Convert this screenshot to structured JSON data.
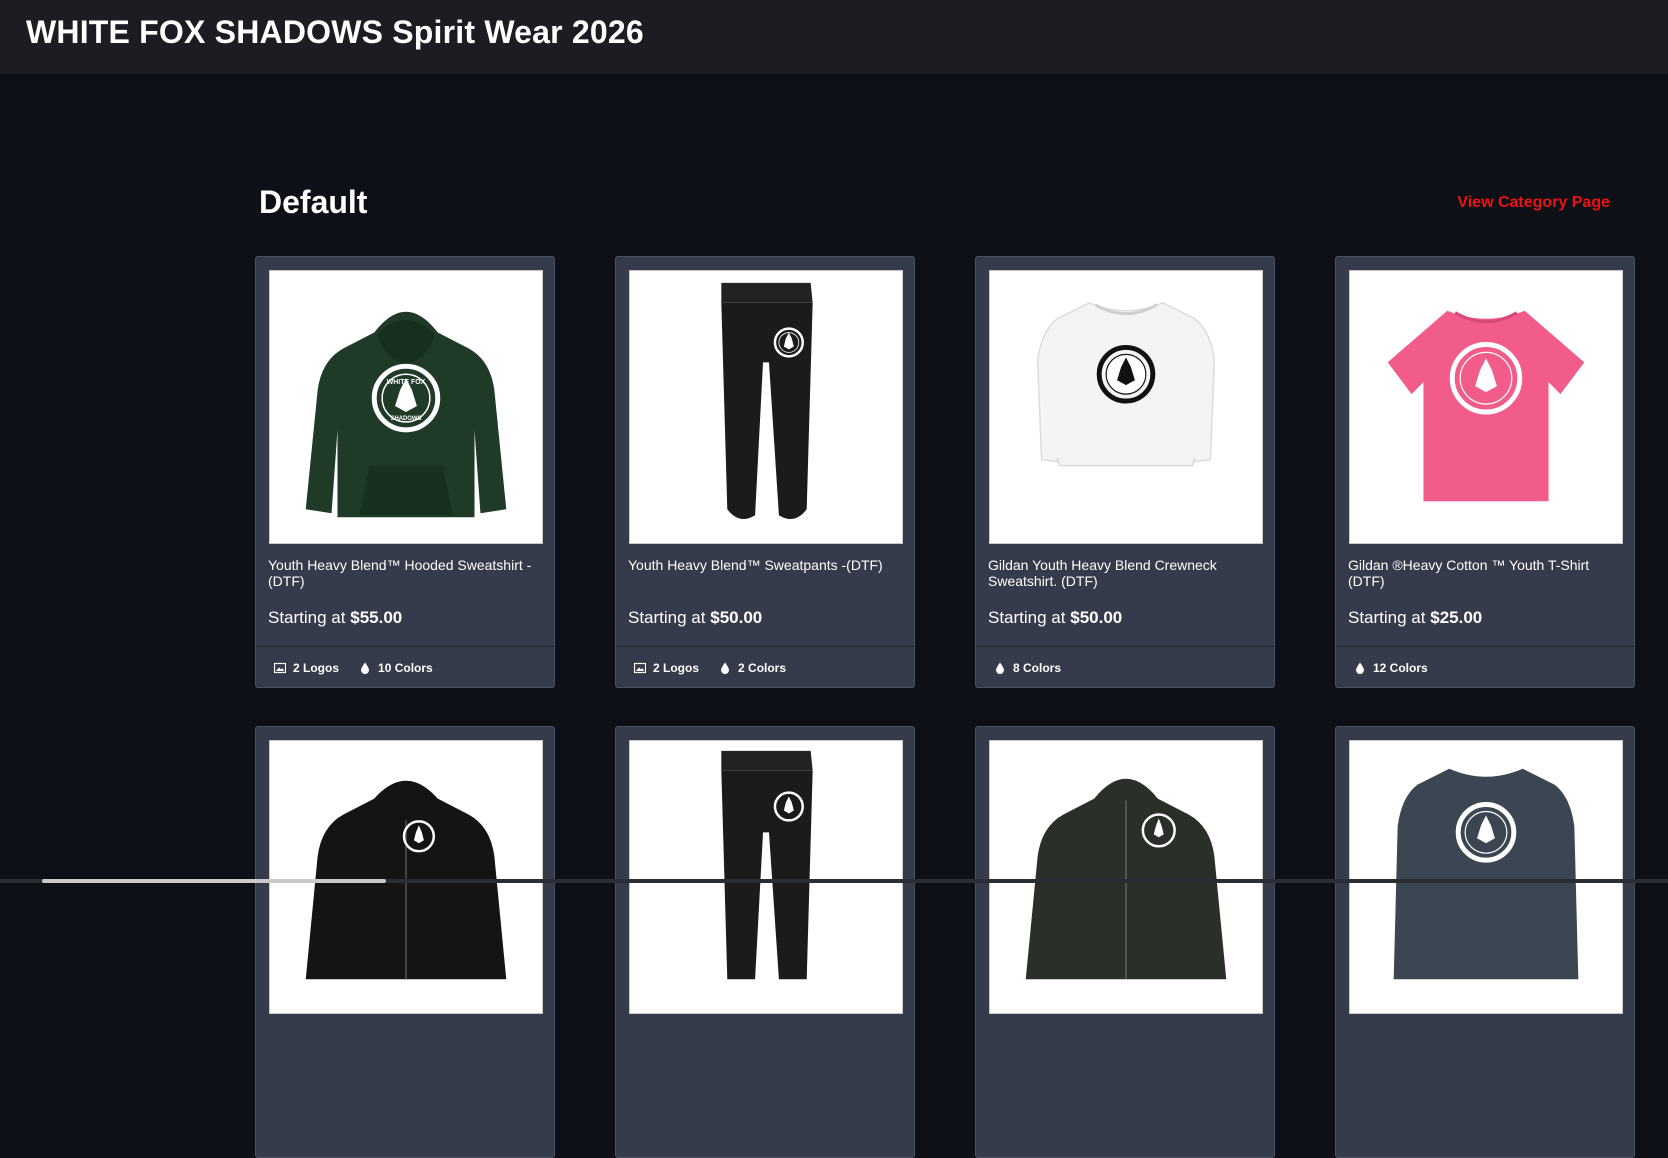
{
  "header": {
    "title": "WHITE FOX SHADOWS Spirit Wear 2026"
  },
  "category": {
    "title": "Default",
    "link_label": "View Category Page"
  },
  "colors": {
    "accent_link": "#ee1111",
    "card_bg": "#353b4a",
    "page_bg": "#0d1117",
    "topbar_bg": "#1b1d22"
  },
  "products": [
    {
      "name": "Youth Heavy Blend™ Hooded Sweatshirt - (DTF)",
      "price_prefix": "Starting at",
      "price": "$55.00",
      "logos": "2 Logos",
      "colors_count": "10 Colors",
      "icon": "hoodie-dark-green"
    },
    {
      "name": "Youth Heavy Blend™ Sweatpants -(DTF)",
      "price_prefix": "Starting at",
      "price": "$50.00",
      "logos": "2 Logos",
      "colors_count": "2 Colors",
      "icon": "sweatpants-black"
    },
    {
      "name": "Gildan Youth Heavy Blend Crewneck Sweatshirt. (DTF)",
      "price_prefix": "Starting at",
      "price": "$50.00",
      "colors_count": "8 Colors",
      "icon": "crewneck-white"
    },
    {
      "name": "Gildan ®Heavy Cotton ™ Youth T-Shirt (DTF)",
      "price_prefix": "Starting at",
      "price": "$25.00",
      "colors_count": "12 Colors",
      "icon": "tshirt-pink"
    },
    {
      "icon": "zip-hoodie-black"
    },
    {
      "icon": "sweatpants-black"
    },
    {
      "icon": "zip-hoodie-dark-green"
    },
    {
      "icon": "crewneck-charcoal"
    }
  ],
  "logo_text": {
    "top": "WHITE FOX",
    "bottom": "SHADOWS"
  }
}
